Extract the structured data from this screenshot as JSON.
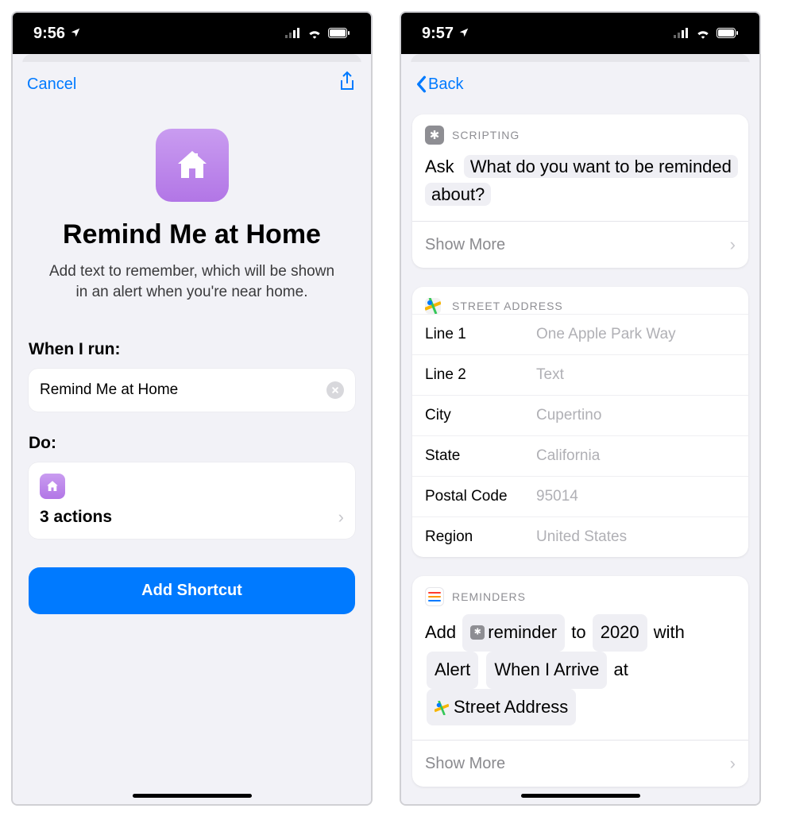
{
  "left": {
    "status_time": "9:56",
    "nav_cancel": "Cancel",
    "title": "Remind Me at Home",
    "subtitle": "Add text to remember, which will be shown in an alert when you're near home.",
    "when_label": "When I run:",
    "shortcut_name": "Remind Me at Home",
    "do_label": "Do:",
    "actions_count": "3 actions",
    "add_button": "Add Shortcut"
  },
  "right": {
    "status_time": "9:57",
    "nav_back": "Back",
    "scripting": {
      "header": "SCRIPTING",
      "ask_word": "Ask",
      "question": "What do you want to be reminded about?",
      "show_more": "Show More"
    },
    "address": {
      "header": "STREET ADDRESS",
      "fields": [
        {
          "label": "Line 1",
          "placeholder": "One Apple Park Way"
        },
        {
          "label": "Line 2",
          "placeholder": "Text"
        },
        {
          "label": "City",
          "placeholder": "Cupertino"
        },
        {
          "label": "State",
          "placeholder": "California"
        },
        {
          "label": "Postal Code",
          "placeholder": "95014"
        },
        {
          "label": "Region",
          "placeholder": "United States"
        }
      ]
    },
    "reminders": {
      "header": "REMINDERS",
      "w_add": "Add",
      "p_reminder": "reminder",
      "w_to": "to",
      "p_list": "2020",
      "w_with": "with",
      "p_alert": "Alert",
      "p_when": "When I Arrive",
      "w_at": "at",
      "p_addr": "Street Address",
      "show_more": "Show More"
    }
  }
}
